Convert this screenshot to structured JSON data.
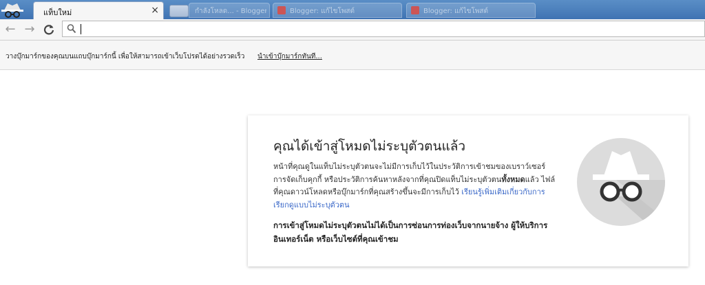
{
  "window": {
    "active_tab": {
      "title": "แท็บใหม่",
      "close": "×"
    },
    "background_tabs": [
      {
        "title": "กำลังโหลด... - Blogger"
      },
      {
        "title": "Blogger: แก้ไขโพสต์"
      },
      {
        "title": "Blogger: แก้ไขโพสต์"
      }
    ]
  },
  "toolbar": {
    "back": "←",
    "forward": "→",
    "reload": "C",
    "omnibox_value": ""
  },
  "bookmark_bar": {
    "message": "วางบุ๊กมาร์กของคุณบนแถบบุ๊กมาร์กนี้ เพื่อให้สามารถเข้าเว็บโปรดได้อย่างรวดเร็ว",
    "import_link": "นำเข้าบุ๊กมาร์กทันที..."
  },
  "incognito": {
    "heading": "คุณได้เข้าสู่โหมดไม่ระบุตัวตนแล้ว",
    "body_part1": "หน้าที่คุณดูในแท็บไม่ระบุตัวตนจะไม่มีการเก็บไว้ในประวัติการเข้าชมของเบราว์เซอร์ การจัดเก็บคุกกี้ หรือประวัติการค้นหาหลังจากที่คุณปิดแท็บไม่ระบุตัวตน",
    "body_bold": "ทั้งหมด",
    "body_part2": "แล้ว ไฟล์ที่คุณดาวน์โหลดหรือบุ๊กมาร์กที่คุณสร้างขึ้นจะมีการเก็บไว้",
    "learn_more": "เรียนรู้เพิ่มเติมเกี่ยวกับการเรียกดูแบบไม่ระบุตัวตน",
    "warning": "การเข้าสู่โหมดไม่ระบุตัวตนไม่ได้เป็นการซ่อนการท่องเว็บจากนายจ้าง ผู้ให้บริการอินเทอร์เน็ต หรือเว็บไซต์ที่คุณเข้าชม"
  },
  "colors": {
    "tabstrip": "#3f73b3",
    "link": "#3a68c8",
    "spy_circle": "#dcdcdc"
  },
  "icons": [
    "incognito-icon",
    "back-icon",
    "forward-icon",
    "reload-icon",
    "search-icon",
    "close-icon",
    "spy-icon"
  ]
}
